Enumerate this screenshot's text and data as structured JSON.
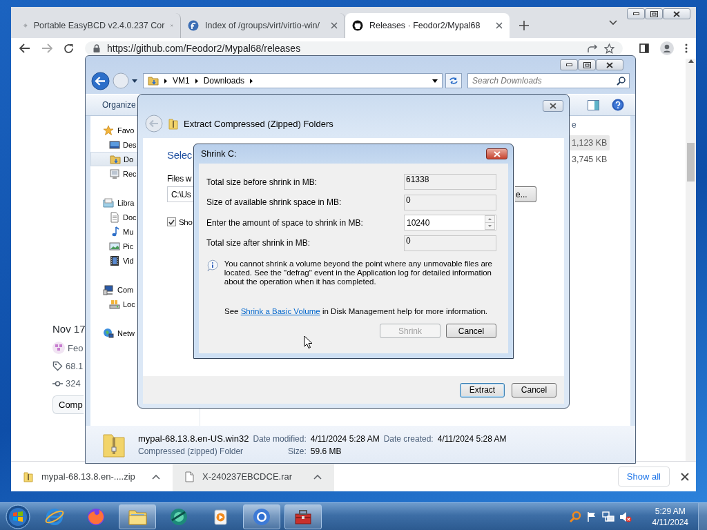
{
  "browser": {
    "tabs": [
      {
        "title": "Portable EasyBCD v2.4.0.237 Cor",
        "kind": "diamond",
        "selected": false
      },
      {
        "title": "Index of /groups/virt/virtio-win/",
        "kind": "fedora",
        "selected": false
      },
      {
        "title": "Releases · Feodor2/Mypal68",
        "kind": "github",
        "selected": true
      }
    ],
    "address": "https://github.com/Feodor2/Mypal68/releases",
    "page": {
      "date": "Nov 17",
      "author": "Feo",
      "tag": "68.1",
      "commits": "324",
      "compare_button": "Comp"
    },
    "downloads": [
      {
        "name": "mypal-68.13.8.en-....zip",
        "kind": "zip",
        "selected": false
      },
      {
        "name": "X-240237EBCDCE.rar",
        "kind": "file",
        "selected": true
      }
    ],
    "show_all": "Show all"
  },
  "explorer": {
    "breadcrumb": [
      "VM1",
      "Downloads"
    ],
    "search_placeholder": "Search Downloads",
    "organize": "Organize",
    "nav": [
      {
        "label": "Favo",
        "kind": "star",
        "selected": false,
        "children": [
          {
            "label": "Des",
            "kind": "desktop",
            "selected": false
          },
          {
            "label": "Do",
            "kind": "downloads",
            "selected": true
          },
          {
            "label": "Rec",
            "kind": "recent",
            "selected": false
          }
        ]
      },
      {
        "label": "Libra",
        "kind": "library",
        "selected": false,
        "children": [
          {
            "label": "Doc",
            "kind": "document",
            "selected": false
          },
          {
            "label": "Mu",
            "kind": "music",
            "selected": false
          },
          {
            "label": "Pic",
            "kind": "pictures",
            "selected": false
          },
          {
            "label": "Vid",
            "kind": "videos",
            "selected": false
          }
        ]
      },
      {
        "label": "Com",
        "kind": "computer",
        "selected": false,
        "children": [
          {
            "label": "Loc",
            "kind": "disk",
            "selected": false
          }
        ]
      },
      {
        "label": "Netw",
        "kind": "network",
        "selected": false
      }
    ],
    "column_3": "e",
    "rows": [
      {
        "size": "1,123 KB",
        "selected": true
      },
      {
        "size": "3,745 KB",
        "selected": false
      }
    ],
    "details": {
      "name": "mypal-68.13.8.en-US.win32",
      "type": "Compressed (zipped) Folder",
      "modified_label": "Date modified:",
      "modified": "4/11/2024 5:28 AM",
      "size_label": "Size:",
      "size": "59.6 MB",
      "created_label": "Date created:",
      "created": "4/11/2024 5:28 AM"
    }
  },
  "extract": {
    "title": "Extract Compressed (Zipped) Folders",
    "heading": "Selec",
    "files_label": "Files w",
    "path": "C:\\Us",
    "browse": "e...",
    "show_files": {
      "label": "Sho",
      "checked": true
    },
    "buttons": [
      {
        "label": "Extract",
        "focused": true
      },
      {
        "label": "Cancel",
        "focused": false
      }
    ]
  },
  "shrink": {
    "title": "Shrink C:",
    "fields": [
      {
        "label": "Total size before shrink in MB:",
        "value": "61338",
        "kind": "readonly"
      },
      {
        "label": "Size of available shrink space in MB:",
        "value": "0",
        "kind": "readonly"
      },
      {
        "label": "Enter the amount of space to shrink in MB:",
        "value": "10240",
        "kind": "spin"
      },
      {
        "label": "Total size after shrink in MB:",
        "value": "0",
        "kind": "readonly"
      }
    ],
    "info": "You cannot shrink a volume beyond the point where any unmovable files are located. See the \"defrag\" event in the Application log for detailed information about the operation when it has completed.",
    "help_before": "See ",
    "help_link": "Shrink a Basic Volume",
    "help_after": " in Disk Management help for more information.",
    "buttons": [
      {
        "label": "Shrink",
        "disabled": true
      },
      {
        "label": "Cancel",
        "disabled": false
      }
    ]
  },
  "taskbar": {
    "apps": [
      {
        "kind": "ie",
        "active": false
      },
      {
        "kind": "firefox",
        "active": false
      },
      {
        "kind": "folder",
        "active": true
      },
      {
        "kind": "sphere",
        "active": false
      },
      {
        "kind": "media",
        "active": false
      },
      {
        "kind": "chrome",
        "active": true
      },
      {
        "kind": "toolbox",
        "active": true
      }
    ],
    "time": "5:29 AM",
    "date": "4/11/2024"
  }
}
